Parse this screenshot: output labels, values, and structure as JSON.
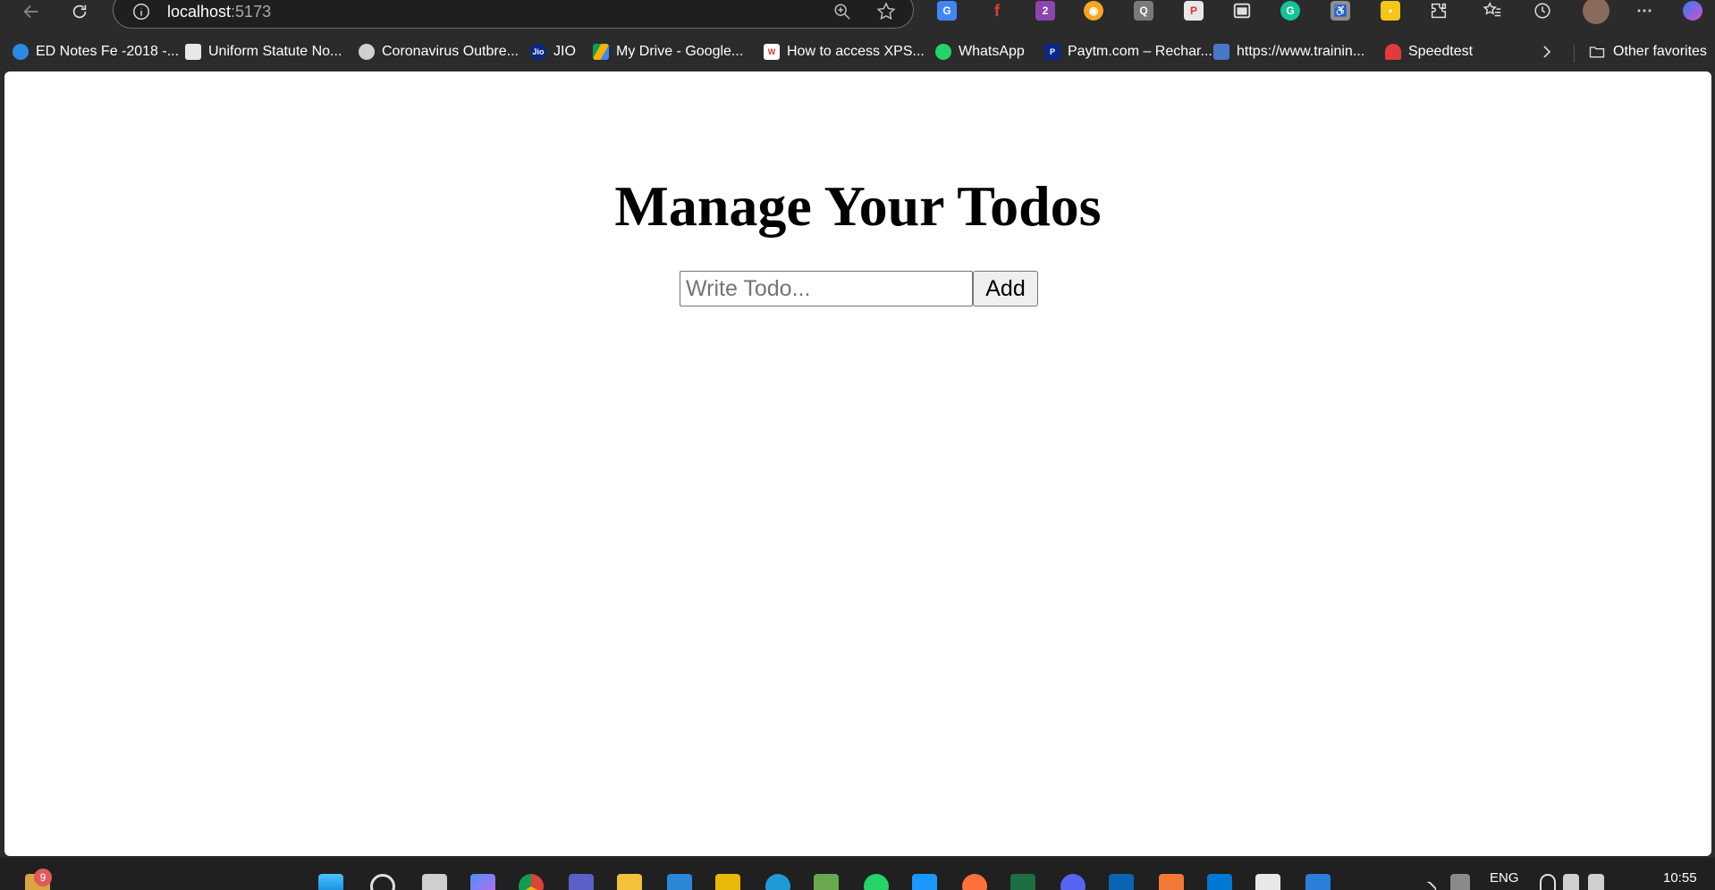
{
  "browser": {
    "address": {
      "host": "localhost",
      "port": ":5173"
    }
  },
  "bookmarks": {
    "items": [
      {
        "label": "ED Notes Fe -2018 -...",
        "icon": "ed-notes-icon",
        "color": "#2b8ae2"
      },
      {
        "label": "Uniform Statute No...",
        "icon": "document-icon",
        "color": "#e8e8e8"
      },
      {
        "label": "Coronavirus Outbre...",
        "icon": "globe-icon",
        "color": "#d0d0d0"
      },
      {
        "label": "JIO",
        "icon": "jio-icon",
        "color": "#0a2885"
      },
      {
        "label": "My Drive - Google...",
        "icon": "google-drive-icon",
        "color": "#f4b400"
      },
      {
        "label": "How to access XPS...",
        "icon": "wiki-icon",
        "color": "#ffffff"
      },
      {
        "label": "WhatsApp",
        "icon": "whatsapp-icon",
        "color": "#25d366"
      },
      {
        "label": "Paytm.com – Rechar...",
        "icon": "paytm-icon",
        "color": "#0a2885"
      },
      {
        "label": "https://www.trainin...",
        "icon": "training-icon",
        "color": "#4a78c6"
      },
      {
        "label": "Speedtest",
        "icon": "speedtest-icon",
        "color": "#e23b3b"
      }
    ],
    "other": "Other favorites"
  },
  "page": {
    "title": "Manage Your Todos",
    "input_placeholder": "Write Todo...",
    "input_value": "",
    "add_label": "Add"
  },
  "taskbar": {
    "notification_count": "9",
    "language": "ENG",
    "time": "10:55"
  }
}
